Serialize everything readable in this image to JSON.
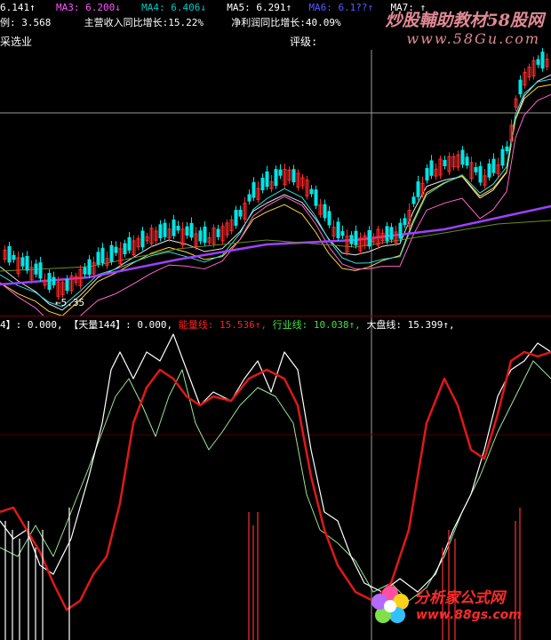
{
  "header": {
    "items": [
      {
        "text": "6.141↑",
        "color": "#ffffff"
      },
      {
        "text": "MA3: 6.200↓",
        "color": "#ff55ff"
      },
      {
        "text": "MA4: 6.406↓",
        "color": "#00c8c8"
      },
      {
        "text": "MA5: 6.291↑",
        "color": "#ffffff"
      },
      {
        "text": "MA6: 6.1??↑",
        "color": "#5a5aff"
      },
      {
        "text": "MA7: ↑",
        "color": "#ffffff"
      }
    ]
  },
  "stats": {
    "ratio": "例: 3.568",
    "revenue_growth": "主营收入同比增长:15.22%",
    "profit_growth": "净利润同比增长:40.09%"
  },
  "industry_label": "采选业",
  "rating_label": "评级:",
  "price_low_label": "5.35",
  "indicator": {
    "items": [
      {
        "text": "4】: 0.000,",
        "color": "#ffffff"
      },
      {
        "text": "【天量144】: 0.000,",
        "color": "#ffffff"
      },
      {
        "text": "能量线: 15.536↑,",
        "color": "#ff2020"
      },
      {
        "text": "行业线: 10.038↑,",
        "color": "#40e040"
      },
      {
        "text": "大盘线: 15.399↑,",
        "color": "#ffffff"
      }
    ]
  },
  "watermark": {
    "line1": "炒股輔助教材58股网",
    "line2": "www.58Gu.com"
  },
  "logo": {
    "title": "分析家公式网",
    "url": "www.88gs.com"
  },
  "colors": {
    "up": "#ff2a2a",
    "down": "#00e5e5",
    "energy": "#e01818",
    "industry": "#9ae59a",
    "market": "#ffffff",
    "crosshair": "#9a9a9a"
  }
}
